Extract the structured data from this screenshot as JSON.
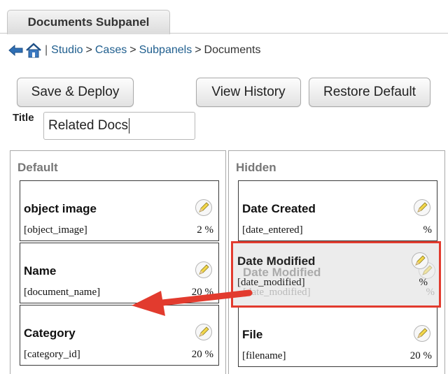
{
  "tab": {
    "label": "Documents Subpanel"
  },
  "breadcrumb": {
    "separator": "|",
    "items": [
      "Studio",
      "Cases",
      "Subpanels",
      "Documents"
    ],
    "divider": ">"
  },
  "toolbar": {
    "save_label": "Save & Deploy",
    "history_label": "View History",
    "restore_label": "Restore Default"
  },
  "title_field": {
    "label": "Title",
    "value": "Related Docs"
  },
  "columns": {
    "default": {
      "heading": "Default",
      "fields": [
        {
          "name": "object image",
          "key": "[object_image]",
          "width": "2 %"
        },
        {
          "name": "Name",
          "key": "[document_name]",
          "width": "20 %"
        },
        {
          "name": "Category",
          "key": "[category_id]",
          "width": "20 %"
        }
      ]
    },
    "hidden": {
      "heading": "Hidden",
      "fields": [
        {
          "name": "Date Created",
          "key": "[date_entered]",
          "width": "%"
        },
        {
          "name": "File",
          "key": "[filename]",
          "width": "20 %"
        }
      ]
    }
  },
  "dragging": {
    "name": "Date Modified",
    "key": "[date_modified]",
    "width": "%"
  },
  "colors": {
    "highlight": "#e23b2e",
    "link": "#1f5e8e",
    "pencil": "#f2d64a"
  },
  "icons": [
    "back-arrow-icon",
    "home-icon",
    "pencil-edit-icon"
  ]
}
